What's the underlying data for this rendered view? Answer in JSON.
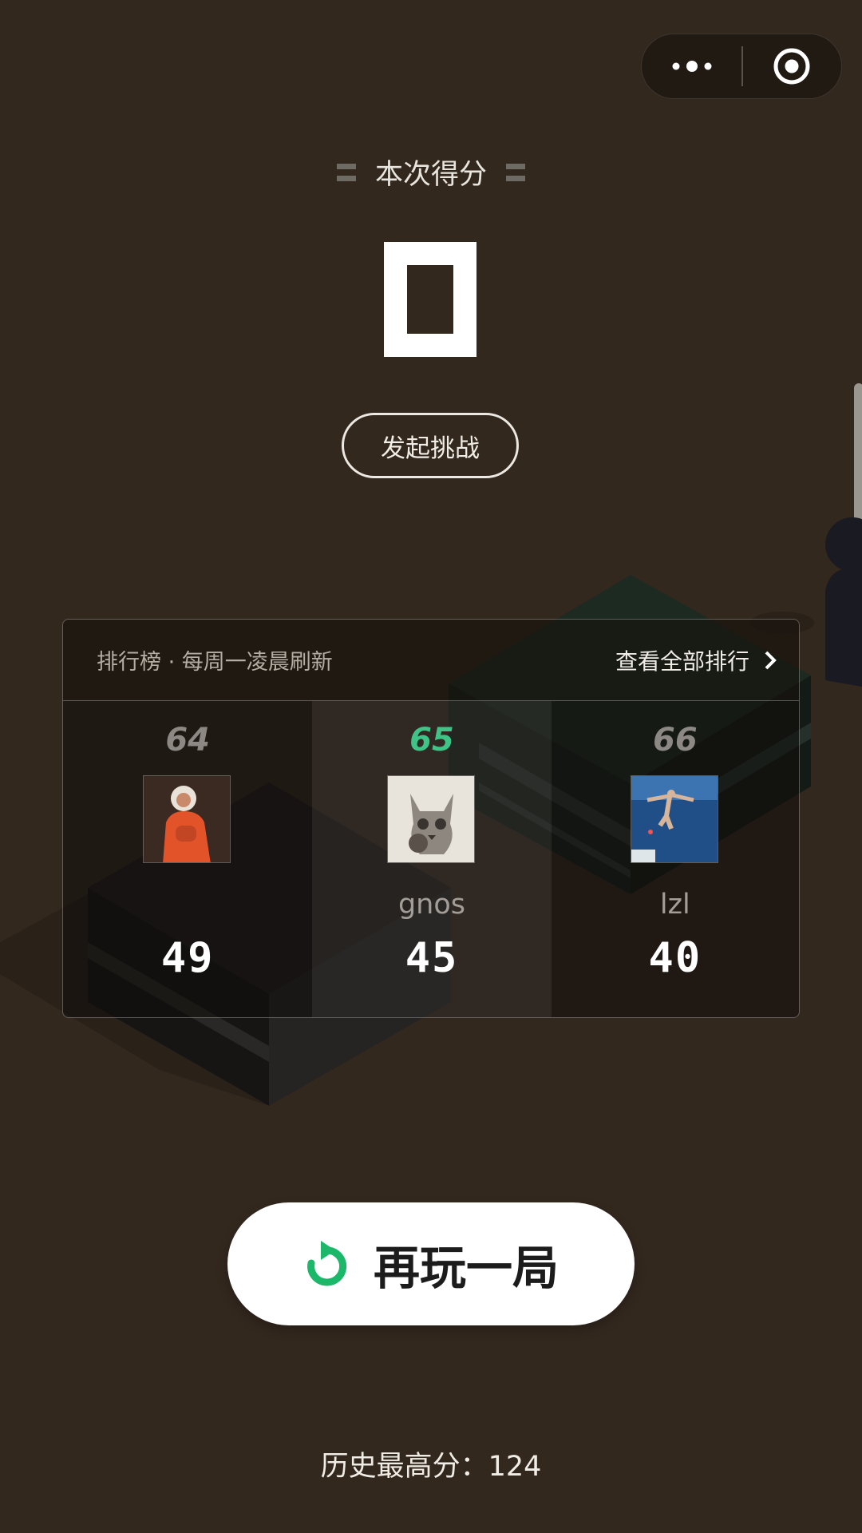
{
  "capsule": {
    "more_icon": "more-dots-icon",
    "close_icon": "target-close-icon"
  },
  "score": {
    "title": "本次得分",
    "value": "0"
  },
  "challenge": {
    "label": "发起挑战"
  },
  "leaderboard": {
    "subtitle": "排行榜 · 每周一凌晨刷新",
    "view_all": "查看全部排行",
    "entries": [
      {
        "rank": "64",
        "nickname": "",
        "score": "49",
        "avatar": "astronaut-avatar",
        "is_self": false
      },
      {
        "rank": "65",
        "nickname": "gnos",
        "score": "45",
        "avatar": "cat-avatar",
        "is_self": true
      },
      {
        "rank": "66",
        "nickname": "lzl",
        "score": "40",
        "avatar": "diving-avatar",
        "is_self": false
      }
    ]
  },
  "replay": {
    "label": "再玩一局",
    "icon": "restart-icon"
  },
  "best": {
    "text": "历史最高分：124"
  },
  "colors": {
    "background": "#33281e",
    "accent": "#3ec487",
    "text": "#ffffff"
  }
}
